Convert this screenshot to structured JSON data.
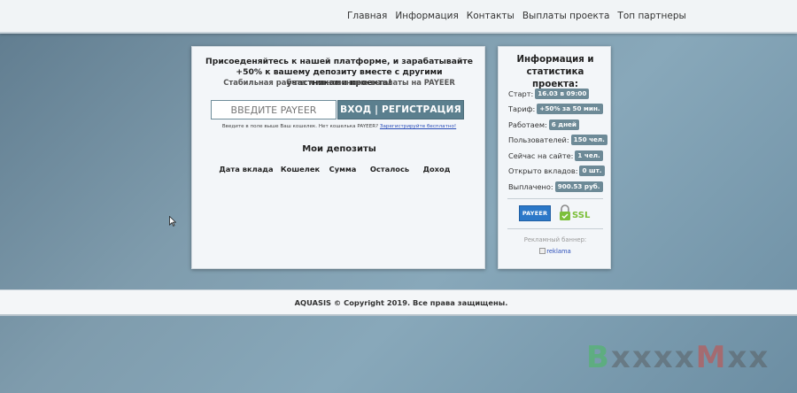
{
  "nav": {
    "items": [
      {
        "label": "Главная"
      },
      {
        "label": "Информация"
      },
      {
        "label": "Контакты"
      },
      {
        "label": "Выплаты проекта"
      },
      {
        "label": "Топ партнеры"
      }
    ]
  },
  "main": {
    "headline": "Присоеденяйтесь к нашей платформе, и зарабатывайте +50% к вашему депозиту вместе с другими участниками проекта!",
    "subline": "Стабильная работа и мгновенные выплаты на PAYEER",
    "wallet_placeholder": "ВВЕДИТЕ PAYEER",
    "wallet_value": "",
    "login_label": "ВХОД | РЕГИСТРАЦИЯ",
    "hint_text": "Введите в поле выше Ваш кошелек. Нет кошелька PAYEER?",
    "hint_link": "Зарегистрируйте бесплатно!",
    "deposits_title": "Мои депозиты",
    "deposits_columns": [
      "Дата вклада",
      "Кошелек",
      "Сумма",
      "Осталось",
      "Доход"
    ]
  },
  "side": {
    "title": "Информация и статистика проекта:",
    "stats": [
      {
        "label": "Старт:",
        "value": "16.03 в 09:00"
      },
      {
        "label": "Тариф:",
        "value": "+50% за 50 мин."
      },
      {
        "label": "Работаем:",
        "value": "6 дней"
      },
      {
        "label": "Пользователей:",
        "value": "150 чел."
      },
      {
        "label": "Сейчас на сайте:",
        "value": "1 чел."
      },
      {
        "label": "Открыто вкладов:",
        "value": "0 шт."
      },
      {
        "label": "Выплачено:",
        "value": "900.53 руб."
      }
    ],
    "payeer_logo_text": "PAYEER",
    "ssl_logo_text": "SSL",
    "ad_label": "Рекламный баннер:",
    "ad_banner_alt": "reklama"
  },
  "footer": {
    "text": "AQUASIS © Copyright 2019. Все права защищены."
  },
  "watermark": {
    "part1": "B",
    "part2": "xxxx",
    "part3": "M",
    "part4": "xx"
  },
  "colors": {
    "accent": "#5b7f8e",
    "badge": "#6d8a97",
    "payeer_blue": "#2b78c8",
    "ssl_green": "#7cbf3a"
  },
  "icons": {
    "cursor": "mouse-pointer-icon",
    "ssl": "padlock-icon",
    "broken_image": "broken-image-icon"
  }
}
